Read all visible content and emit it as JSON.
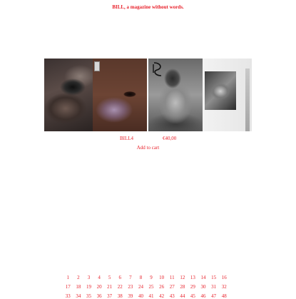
{
  "header": {
    "title": "BILL, a magazine without words."
  },
  "product": {
    "name": "BILL4",
    "price": "€40,00",
    "add_to_cart": "Add to cart"
  },
  "pagination": {
    "pages": [
      "1",
      "2",
      "3",
      "4",
      "5",
      "6",
      "7",
      "8",
      "9",
      "10",
      "11",
      "12",
      "13",
      "14",
      "15",
      "16",
      "17",
      "18",
      "19",
      "20",
      "21",
      "22",
      "23",
      "24",
      "25",
      "26",
      "27",
      "28",
      "29",
      "30",
      "31",
      "32",
      "33",
      "34",
      "35",
      "36",
      "37",
      "38",
      "39",
      "40",
      "41",
      "42",
      "43",
      "44",
      "45",
      "46",
      "47",
      "48"
    ]
  },
  "colors": {
    "accent": "#e8202a",
    "background": "#ffffff"
  }
}
